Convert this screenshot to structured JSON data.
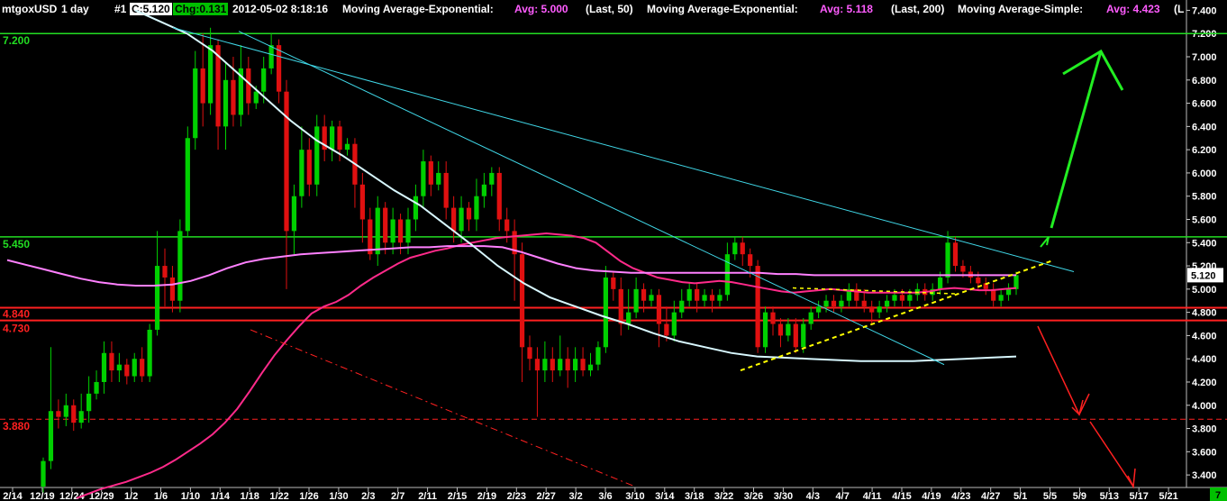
{
  "header": {
    "symbol": "mtgoxUSD",
    "interval": "1 day",
    "bar_num": "#1",
    "close_label": "C:5.120",
    "chg_label": "Chg:0.131",
    "datetime": "2012-05-02  8:18:16",
    "ma1_name": "Moving Average-Exponential:",
    "ma1_avg": "Avg: 5.000",
    "ma1_last": "(Last, 50)",
    "ma2_name": "Moving Average-Exponential:",
    "ma2_avg": "Avg: 5.118",
    "ma2_last": "(Last, 200)",
    "ma3_name": "Moving Average-Simple:",
    "ma3_avg": "Avg: 4.423",
    "ma3_last": "(L"
  },
  "colors": {
    "up": "#00d000",
    "down": "#e01010",
    "ema50": "#ff2a8a",
    "ema200": "#ff80ff",
    "sma": "#d8f8ff",
    "trend": "#40d8e8",
    "hline_green": "#22dd22",
    "hline_red": "#ff2020",
    "support": "#ffff00",
    "arrow_up": "#22ee22",
    "arrow_down": "#ff2020"
  },
  "chart_data": {
    "type": "candlestick",
    "ylim": [
      3.3,
      7.45
    ],
    "y_ticks": [
      "7.400",
      "7.200",
      "7.000",
      "6.800",
      "6.600",
      "6.400",
      "6.200",
      "6.000",
      "5.800",
      "5.600",
      "5.400",
      "5.200",
      "5.000",
      "4.800",
      "4.600",
      "4.400",
      "4.200",
      "4.000",
      "3.800",
      "3.600",
      "3.400"
    ],
    "x_ticks": [
      "2/14",
      "12/19",
      "12/24",
      "12/29",
      "1/2",
      "1/6",
      "1/10",
      "1/14",
      "1/18",
      "1/22",
      "1/26",
      "1/30",
      "2/3",
      "2/7",
      "2/11",
      "2/15",
      "2/19",
      "2/23",
      "2/27",
      "3/2",
      "3/6",
      "3/10",
      "3/14",
      "3/18",
      "3/22",
      "3/26",
      "3/30",
      "4/3",
      "4/7",
      "4/11",
      "4/15",
      "4/19",
      "4/23",
      "4/27",
      "5/1",
      "5/5",
      "5/9",
      "5/13",
      "5/17",
      "5/21"
    ],
    "last_price_label": "5.120",
    "corner_label": "7",
    "levels": [
      {
        "label": "7.200",
        "value": 7.2,
        "color": "green"
      },
      {
        "label": "5.450",
        "value": 5.45,
        "color": "green"
      },
      {
        "label": "4.840",
        "value": 4.84,
        "color": "red"
      },
      {
        "label": "4.730",
        "value": 4.73,
        "color": "red"
      },
      {
        "label": "3.880",
        "value": 3.88,
        "color": "red-dashed"
      }
    ],
    "candles": [
      [
        3.3,
        3.52,
        3.25,
        3.55
      ],
      [
        3.52,
        3.95,
        3.45,
        4.5
      ],
      [
        3.95,
        3.9,
        3.8,
        4.05
      ],
      [
        3.9,
        4.0,
        3.82,
        4.1
      ],
      [
        4.0,
        3.85,
        3.78,
        4.05
      ],
      [
        3.85,
        3.95,
        3.8,
        4.1
      ],
      [
        3.95,
        4.1,
        3.85,
        4.25
      ],
      [
        4.1,
        4.2,
        4.05,
        4.3
      ],
      [
        4.2,
        4.45,
        4.1,
        4.55
      ],
      [
        4.45,
        4.3,
        4.2,
        4.55
      ],
      [
        4.3,
        4.35,
        4.2,
        4.45
      ],
      [
        4.35,
        4.25,
        4.18,
        4.4
      ],
      [
        4.25,
        4.4,
        4.2,
        4.45
      ],
      [
        4.4,
        4.25,
        4.2,
        4.5
      ],
      [
        4.25,
        4.65,
        4.2,
        4.7
      ],
      [
        4.65,
        5.2,
        4.6,
        5.5
      ],
      [
        5.2,
        5.1,
        4.85,
        5.35
      ],
      [
        5.1,
        4.9,
        4.8,
        5.2
      ],
      [
        4.9,
        5.5,
        4.8,
        5.6
      ],
      [
        5.5,
        6.3,
        5.45,
        6.4
      ],
      [
        6.3,
        6.9,
        6.2,
        7.05
      ],
      [
        6.9,
        6.6,
        6.4,
        7.2
      ],
      [
        6.6,
        7.1,
        6.5,
        7.25
      ],
      [
        7.1,
        6.4,
        6.2,
        7.15
      ],
      [
        6.4,
        6.8,
        6.2,
        6.95
      ],
      [
        6.8,
        6.5,
        6.4,
        7.0
      ],
      [
        6.5,
        6.9,
        6.4,
        7.1
      ],
      [
        6.9,
        6.6,
        6.5,
        7.0
      ],
      [
        6.6,
        6.7,
        6.55,
        6.75
      ],
      [
        6.7,
        6.9,
        6.6,
        7.0
      ],
      [
        6.9,
        7.1,
        6.85,
        7.2
      ],
      [
        7.1,
        6.7,
        6.6,
        7.15
      ],
      [
        6.7,
        5.5,
        5.0,
        6.8
      ],
      [
        5.5,
        5.8,
        5.3,
        5.9
      ],
      [
        5.8,
        6.2,
        5.7,
        6.4
      ],
      [
        6.2,
        5.9,
        5.8,
        6.3
      ],
      [
        5.9,
        6.4,
        5.8,
        6.5
      ],
      [
        6.4,
        6.2,
        6.1,
        6.5
      ],
      [
        6.2,
        6.4,
        6.1,
        6.45
      ],
      [
        6.4,
        6.2,
        6.1,
        6.45
      ],
      [
        6.2,
        6.25,
        6.15,
        6.3
      ],
      [
        6.25,
        5.9,
        5.7,
        6.3
      ],
      [
        5.9,
        5.6,
        5.4,
        6.0
      ],
      [
        5.6,
        5.3,
        5.25,
        5.7
      ],
      [
        5.3,
        5.7,
        5.2,
        5.8
      ],
      [
        5.7,
        5.4,
        5.3,
        5.75
      ],
      [
        5.4,
        5.6,
        5.3,
        5.7
      ],
      [
        5.6,
        5.4,
        5.3,
        5.65
      ],
      [
        5.4,
        5.6,
        5.3,
        5.7
      ],
      [
        5.6,
        5.8,
        5.5,
        5.9
      ],
      [
        5.8,
        6.1,
        5.7,
        6.2
      ],
      [
        6.1,
        5.9,
        5.8,
        6.15
      ],
      [
        5.9,
        6.0,
        5.85,
        6.1
      ],
      [
        6.0,
        5.7,
        5.6,
        6.1
      ],
      [
        5.7,
        5.5,
        5.4,
        5.8
      ],
      [
        5.5,
        5.7,
        5.4,
        5.8
      ],
      [
        5.7,
        5.6,
        5.5,
        5.75
      ],
      [
        5.6,
        5.8,
        5.5,
        5.95
      ],
      [
        5.8,
        5.9,
        5.7,
        6.0
      ],
      [
        5.9,
        6.0,
        5.8,
        6.05
      ],
      [
        6.0,
        5.6,
        5.5,
        6.05
      ],
      [
        5.6,
        5.5,
        5.4,
        5.7
      ],
      [
        5.5,
        5.3,
        4.9,
        5.6
      ],
      [
        5.3,
        4.5,
        4.2,
        5.4
      ],
      [
        4.5,
        4.4,
        4.3,
        4.6
      ],
      [
        4.4,
        4.3,
        3.9,
        4.5
      ],
      [
        4.3,
        4.4,
        4.2,
        4.55
      ],
      [
        4.4,
        4.3,
        4.2,
        4.5
      ],
      [
        4.3,
        4.4,
        4.25,
        4.6
      ],
      [
        4.4,
        4.3,
        4.15,
        4.5
      ],
      [
        4.3,
        4.4,
        4.2,
        4.5
      ],
      [
        4.4,
        4.3,
        4.25,
        4.5
      ],
      [
        4.3,
        4.35,
        4.25,
        4.45
      ],
      [
        4.35,
        4.5,
        4.3,
        4.55
      ],
      [
        4.5,
        5.1,
        4.45,
        5.2
      ],
      [
        5.1,
        5.0,
        4.9,
        5.15
      ],
      [
        5.0,
        4.7,
        4.6,
        5.1
      ],
      [
        4.7,
        4.8,
        4.65,
        5.0
      ],
      [
        4.8,
        5.0,
        4.75,
        5.1
      ],
      [
        5.0,
        4.9,
        4.8,
        5.05
      ],
      [
        4.9,
        4.95,
        4.85,
        5.0
      ],
      [
        4.95,
        4.7,
        4.5,
        5.0
      ],
      [
        4.7,
        4.6,
        4.55,
        4.85
      ],
      [
        4.6,
        4.8,
        4.55,
        4.9
      ],
      [
        4.8,
        4.9,
        4.75,
        5.0
      ],
      [
        4.9,
        5.0,
        4.85,
        5.05
      ],
      [
        5.0,
        4.9,
        4.8,
        5.05
      ],
      [
        4.9,
        4.95,
        4.85,
        5.0
      ],
      [
        4.95,
        4.9,
        4.8,
        5.0
      ],
      [
        4.9,
        4.95,
        4.85,
        5.0
      ],
      [
        4.95,
        5.3,
        4.9,
        5.4
      ],
      [
        5.3,
        5.4,
        5.25,
        5.45
      ],
      [
        5.4,
        5.3,
        5.2,
        5.45
      ],
      [
        5.3,
        5.2,
        5.1,
        5.35
      ],
      [
        5.2,
        4.5,
        4.45,
        5.25
      ],
      [
        4.5,
        4.8,
        4.45,
        4.85
      ],
      [
        4.8,
        4.7,
        4.6,
        4.85
      ],
      [
        4.7,
        4.6,
        4.5,
        4.75
      ],
      [
        4.6,
        4.7,
        4.55,
        4.75
      ],
      [
        4.7,
        4.5,
        4.45,
        4.75
      ],
      [
        4.5,
        4.7,
        4.45,
        4.75
      ],
      [
        4.7,
        4.8,
        4.65,
        4.85
      ],
      [
        4.8,
        4.85,
        4.75,
        4.9
      ],
      [
        4.85,
        4.9,
        4.8,
        4.95
      ],
      [
        4.9,
        4.85,
        4.8,
        4.95
      ],
      [
        4.85,
        4.9,
        4.8,
        4.95
      ],
      [
        4.9,
        5.0,
        4.85,
        5.05
      ],
      [
        5.0,
        4.9,
        4.85,
        5.05
      ],
      [
        4.9,
        4.85,
        4.8,
        5.0
      ],
      [
        4.85,
        4.8,
        4.7,
        4.9
      ],
      [
        4.8,
        4.85,
        4.75,
        4.9
      ],
      [
        4.85,
        4.9,
        4.8,
        4.95
      ],
      [
        4.9,
        4.95,
        4.85,
        5.0
      ],
      [
        4.95,
        4.9,
        4.85,
        5.0
      ],
      [
        4.9,
        4.95,
        4.85,
        5.0
      ],
      [
        4.95,
        5.0,
        4.9,
        5.05
      ],
      [
        5.0,
        4.95,
        4.9,
        5.05
      ],
      [
        4.95,
        5.0,
        4.9,
        5.05
      ],
      [
        5.0,
        5.1,
        4.95,
        5.15
      ],
      [
        5.1,
        5.4,
        5.05,
        5.5
      ],
      [
        5.4,
        5.2,
        5.15,
        5.45
      ],
      [
        5.2,
        5.15,
        5.1,
        5.25
      ],
      [
        5.15,
        5.1,
        5.05,
        5.2
      ],
      [
        5.1,
        5.05,
        5.0,
        5.15
      ],
      [
        5.05,
        5.0,
        4.95,
        5.1
      ],
      [
        5.0,
        4.9,
        4.85,
        5.05
      ],
      [
        4.9,
        4.95,
        4.85,
        5.0
      ],
      [
        4.95,
        5.0,
        4.9,
        5.05
      ],
      [
        5.0,
        5.12,
        4.95,
        5.15
      ]
    ],
    "series": [
      {
        "type": "ema",
        "period": 50,
        "values": [
          3.2,
          3.24,
          3.28,
          3.31,
          3.34,
          3.38,
          3.42,
          3.47,
          3.53,
          3.6,
          3.67,
          3.75,
          3.85,
          3.97,
          4.12,
          4.28,
          4.43,
          4.56,
          4.68,
          4.79,
          4.85,
          4.89,
          4.95,
          5.03,
          5.1,
          5.16,
          5.22,
          5.27,
          5.3,
          5.33,
          5.35,
          5.38,
          5.4,
          5.42,
          5.44,
          5.45,
          5.46,
          5.47,
          5.48,
          5.47,
          5.46,
          5.44,
          5.4,
          5.32,
          5.24,
          5.18,
          5.14,
          5.1,
          5.08,
          5.06,
          5.05,
          5.06,
          5.07,
          5.06,
          5.04,
          5.02,
          5.0,
          4.98,
          4.97,
          4.98,
          4.99,
          5.0,
          4.99,
          4.98,
          4.97,
          4.97,
          4.97,
          4.97,
          4.97,
          4.98,
          5.0,
          5.01,
          5.0,
          4.99,
          4.99,
          5.0,
          5.01
        ]
      },
      {
        "type": "ema",
        "period": 200,
        "values": [
          5.25,
          5.21,
          5.17,
          5.13,
          5.09,
          5.06,
          5.04,
          5.03,
          5.03,
          5.04,
          5.07,
          5.12,
          5.18,
          5.23,
          5.26,
          5.28,
          5.3,
          5.31,
          5.32,
          5.33,
          5.34,
          5.35,
          5.36,
          5.36,
          5.37,
          5.37,
          5.37,
          5.36,
          5.32,
          5.27,
          5.22,
          5.18,
          5.16,
          5.15,
          5.14,
          5.14,
          5.14,
          5.14,
          5.14,
          5.14,
          5.14,
          5.14,
          5.13,
          5.13,
          5.12,
          5.12,
          5.12,
          5.12,
          5.12,
          5.12,
          5.12,
          5.12,
          5.12,
          5.12,
          5.12,
          5.12
        ]
      },
      {
        "type": "sma",
        "values": [
          7.4,
          7.3,
          7.2,
          7.05,
          6.85,
          6.65,
          6.45,
          6.28,
          6.15,
          6.0,
          5.85,
          5.72,
          5.55,
          5.38,
          5.2,
          5.05,
          4.93,
          4.85,
          4.77,
          4.7,
          4.62,
          4.55,
          4.5,
          4.45,
          4.42,
          4.41,
          4.4,
          4.39,
          4.38,
          4.38,
          4.38,
          4.39,
          4.4,
          4.41,
          4.42
        ]
      }
    ],
    "trendlines": [
      {
        "kind": "resistance-upper",
        "from": [
          7.25,
          0
        ],
        "to": [
          5.15,
          1
        ]
      },
      {
        "kind": "resistance-lower",
        "from": [
          7.22,
          0
        ],
        "to": [
          4.35,
          1
        ]
      },
      {
        "kind": "support",
        "from": [
          4.3,
          0
        ],
        "to": [
          5.25,
          1
        ]
      },
      {
        "kind": "red-projection",
        "from": [
          4.65,
          0
        ],
        "to": [
          3.3,
          1
        ]
      }
    ]
  }
}
